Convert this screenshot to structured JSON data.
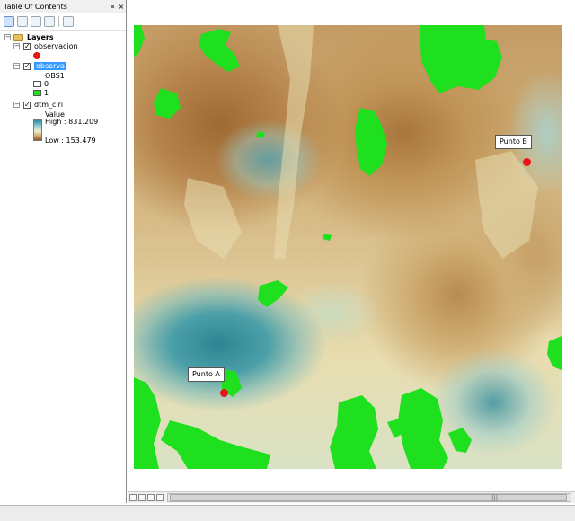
{
  "toc": {
    "title": "Table Of Contents",
    "pin": "✂",
    "close": "×",
    "root_label": "Layers",
    "layers": [
      {
        "name": "observacion",
        "checked": true,
        "symbol_color": "#e8141a"
      },
      {
        "name": "observa",
        "checked": true,
        "field": "OBS1",
        "classes": [
          {
            "label": "0",
            "color": "#ffffff"
          },
          {
            "label": "1",
            "color": "#1ee01e"
          }
        ]
      },
      {
        "name": "dtm_ciri",
        "checked": true,
        "value_heading": "Value",
        "high_label": "High : 831.209",
        "low_label": "Low : 153.479"
      }
    ]
  },
  "map": {
    "points": [
      {
        "label": "Punto A",
        "color": "#e8141a"
      },
      {
        "label": "Punto B",
        "color": "#e8141a"
      }
    ],
    "visible_color": "#1ee01e"
  }
}
